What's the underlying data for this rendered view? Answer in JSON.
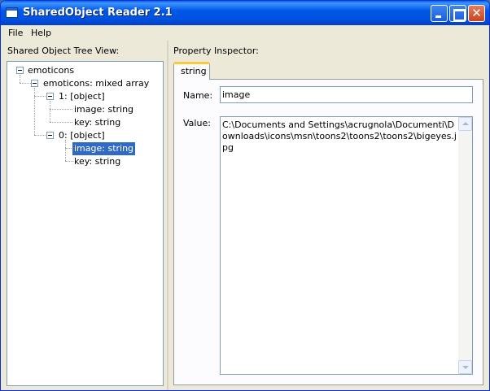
{
  "window": {
    "title": "SharedObject Reader 2.1"
  },
  "menu": {
    "file": "File",
    "help": "Help"
  },
  "left_panel": {
    "label": "Shared Object Tree View:",
    "tree": [
      {
        "label": "emoticons",
        "expanded": true
      },
      {
        "label": "emoticons: mixed array",
        "expanded": true
      },
      {
        "label": "1: [object]",
        "expanded": true
      },
      {
        "label": "image: string"
      },
      {
        "label": "key: string"
      },
      {
        "label": "0: [object]",
        "expanded": true
      },
      {
        "label": "image: string",
        "selected": true
      },
      {
        "label": "key: string"
      }
    ]
  },
  "right_panel": {
    "label": "Property Inspector:",
    "tab": "string",
    "name_label": "Name:",
    "name_value": "image",
    "value_label": "Value:",
    "value_text": "C:\\Documents and Settings\\acrugnola\\Documenti\\Downloads\\icons\\msn\\toons2\\toons2\\toons2\\bigeyes.jpg"
  }
}
